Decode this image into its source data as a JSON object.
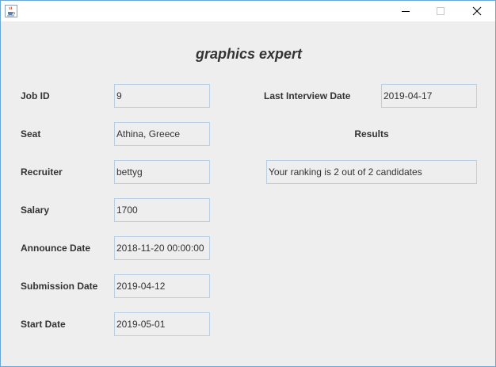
{
  "window": {
    "title": ""
  },
  "heading": "graphics expert",
  "left_fields": [
    {
      "label": "Job ID",
      "value": "9"
    },
    {
      "label": "Seat",
      "value": "Athina, Greece"
    },
    {
      "label": "Recruiter",
      "value": "bettyg"
    },
    {
      "label": "Salary",
      "value": "1700"
    },
    {
      "label": "Announce Date",
      "value": "2018-11-20 00:00:00"
    },
    {
      "label": "Submission Date",
      "value": "2019-04-12"
    },
    {
      "label": "Start Date",
      "value": "2019-05-01"
    }
  ],
  "right": {
    "last_interview_label": "Last Interview Date",
    "last_interview_value": "2019-04-17",
    "results_label": "Results",
    "results_value": "Your ranking is 2 out of 2 candidates"
  },
  "icons": {
    "app": "java-cup-icon",
    "minimize": "minimize-icon",
    "maximize": "maximize-icon",
    "close": "close-icon"
  }
}
